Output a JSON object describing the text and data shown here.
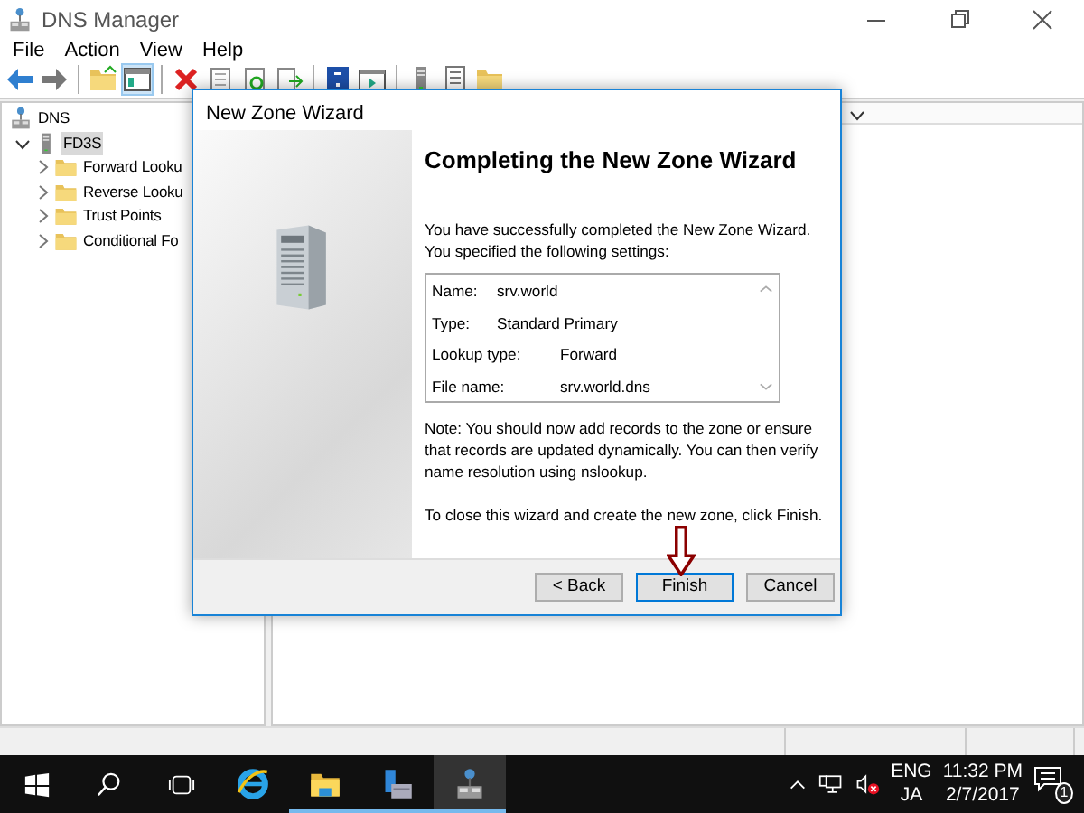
{
  "window": {
    "title": "DNS Manager"
  },
  "menu": [
    "File",
    "Action",
    "View",
    "Help"
  ],
  "tree": [
    {
      "label": "DNS",
      "kind": "root",
      "selected": false,
      "children": [
        {
          "label": "FD3S",
          "kind": "server",
          "selected": true,
          "expanded": true,
          "children": [
            {
              "label": "Forward Looku",
              "kind": "folder",
              "selected": false,
              "expanded": false
            },
            {
              "label": "Reverse Looku",
              "kind": "folder",
              "selected": false,
              "expanded": false
            },
            {
              "label": "Trust Points",
              "kind": "folder",
              "selected": false,
              "expanded": false
            },
            {
              "label": "Conditional Fo",
              "kind": "folder",
              "selected": false,
              "expanded": false
            }
          ]
        }
      ]
    }
  ],
  "dialog": {
    "title": "New Zone Wizard",
    "heading": "Completing the New Zone Wizard",
    "intro": "You have successfully completed the New Zone Wizard. You specified the following settings:",
    "settings": [
      {
        "label": "Name:",
        "value": "srv.world",
        "kind": "short"
      },
      {
        "label": "Type:",
        "value": "Standard Primary",
        "kind": "short"
      },
      {
        "label": "Lookup type:",
        "value": "Forward",
        "kind": "long"
      },
      {
        "label": "File name:",
        "value": "srv.world.dns",
        "kind": "long"
      }
    ],
    "note": "Note: You should now add records to the zone or ensure that records are updated dynamically. You can then verify name resolution using nslookup.",
    "closing": "To close this wizard and create the new zone, click Finish.",
    "buttons": [
      {
        "label": "< Back",
        "default": false
      },
      {
        "label": "Finish",
        "default": true
      },
      {
        "label": "Cancel",
        "default": false
      }
    ]
  },
  "taskbar": {
    "apps": [
      {
        "kind": "ie",
        "active": false,
        "running": false
      },
      {
        "kind": "explorer",
        "active": false,
        "running": true
      },
      {
        "kind": "server",
        "active": false,
        "running": true
      },
      {
        "kind": "dns",
        "active": true,
        "running": true
      }
    ],
    "language": "ENG",
    "ime": "JA",
    "time": "11:32 PM",
    "date": "2/7/2017",
    "notifications": "1"
  }
}
